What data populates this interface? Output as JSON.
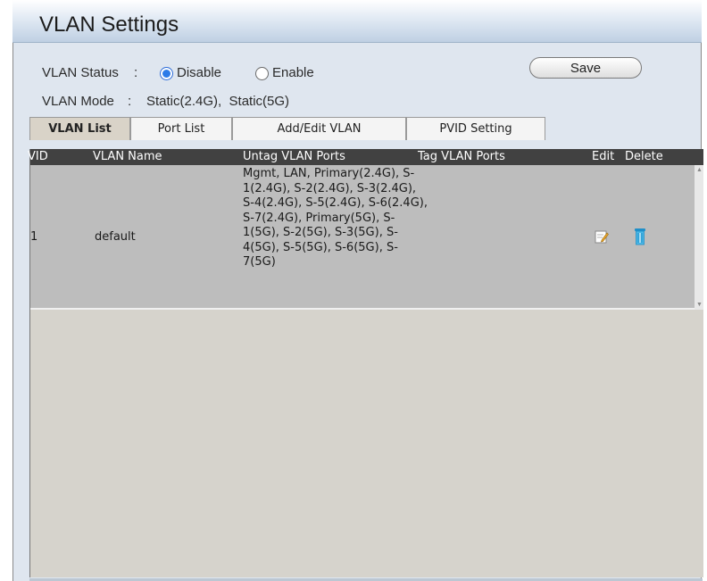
{
  "header": {
    "title": "VLAN Settings"
  },
  "status": {
    "label": "VLAN Status",
    "separator": ":",
    "options": [
      {
        "label": "Disable",
        "checked": true
      },
      {
        "label": "Enable",
        "checked": false
      }
    ]
  },
  "mode": {
    "label": "VLAN Mode",
    "separator": ":",
    "value": "Static(2.4G),  Static(5G)"
  },
  "save_label": "Save",
  "tabs": [
    {
      "label": "VLAN List",
      "active": true
    },
    {
      "label": "Port List",
      "active": false
    },
    {
      "label": "Add/Edit VLAN",
      "active": false
    },
    {
      "label": "PVID Setting",
      "active": false
    }
  ],
  "table": {
    "columns": [
      "VID",
      "VLAN Name",
      "Untag VLAN Ports",
      "Tag VLAN Ports",
      "Edit",
      "Delete"
    ],
    "rows": [
      {
        "vid": "1",
        "name": "default",
        "untag_ports": "Mgmt, LAN, Primary(2.4G), S-1(2.4G), S-2(2.4G), S-3(2.4G), S-4(2.4G), S-5(2.4G), S-6(2.4G), S-7(2.4G), Primary(5G), S-1(5G), S-2(5G), S-3(5G), S-4(5G), S-5(5G), S-6(5G), S-7(5G)",
        "tag_ports": ""
      }
    ]
  },
  "icons": {
    "edit": "edit-icon",
    "delete": "trash-icon"
  },
  "colors": {
    "accent": "#2c7be8",
    "header_bg": "#414141",
    "row_bg": "#bdbdbd"
  }
}
